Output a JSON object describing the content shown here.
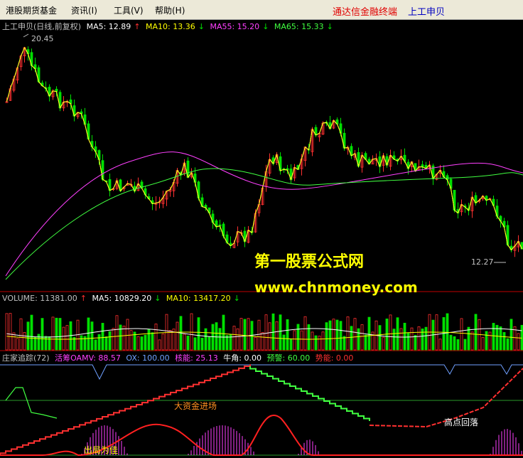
{
  "menu": {
    "items": [
      "港股期货基金",
      "资讯(I)",
      "工具(V)",
      "帮助(H)"
    ],
    "broker": "通达信金融终端",
    "stock": "上工申贝"
  },
  "price_panel": {
    "title": "上工申贝(日线,前复权)",
    "ma5": "MA5: 12.89",
    "ma10": "MA10: 13.36",
    "ma55": "MA55: 15.20",
    "ma65": "MA65: 15.33",
    "high_label": "20.45",
    "low_label": "12.27"
  },
  "volume_panel": {
    "volume": "VOLUME: 11381.00",
    "ma5": "MA5: 10829.20",
    "ma10": "MA10: 13417.20"
  },
  "indicator_panel": {
    "title": "庄家追踪(72)",
    "oamv": "活筹OAMV: 88.57",
    "ox": "OX: 100.00",
    "core": "核能: 25.13",
    "bull": "牛角: 0.00",
    "warn": "预警: 60.00",
    "power": "势能: 0.00",
    "annotations": [
      "大资金进场",
      "高点回落",
      "出局为佳"
    ]
  },
  "watermark": {
    "line1": "第一股票公式网",
    "line2": "www.chnmoney.com"
  },
  "colors": {
    "up": "#ff3030",
    "down": "#00e000",
    "ma5": "#ffffff",
    "ma10": "#ffff00",
    "ma55": "#ff40ff",
    "ma65": "#40ff40",
    "background": "#000000",
    "watermark": "#ffff00"
  }
}
